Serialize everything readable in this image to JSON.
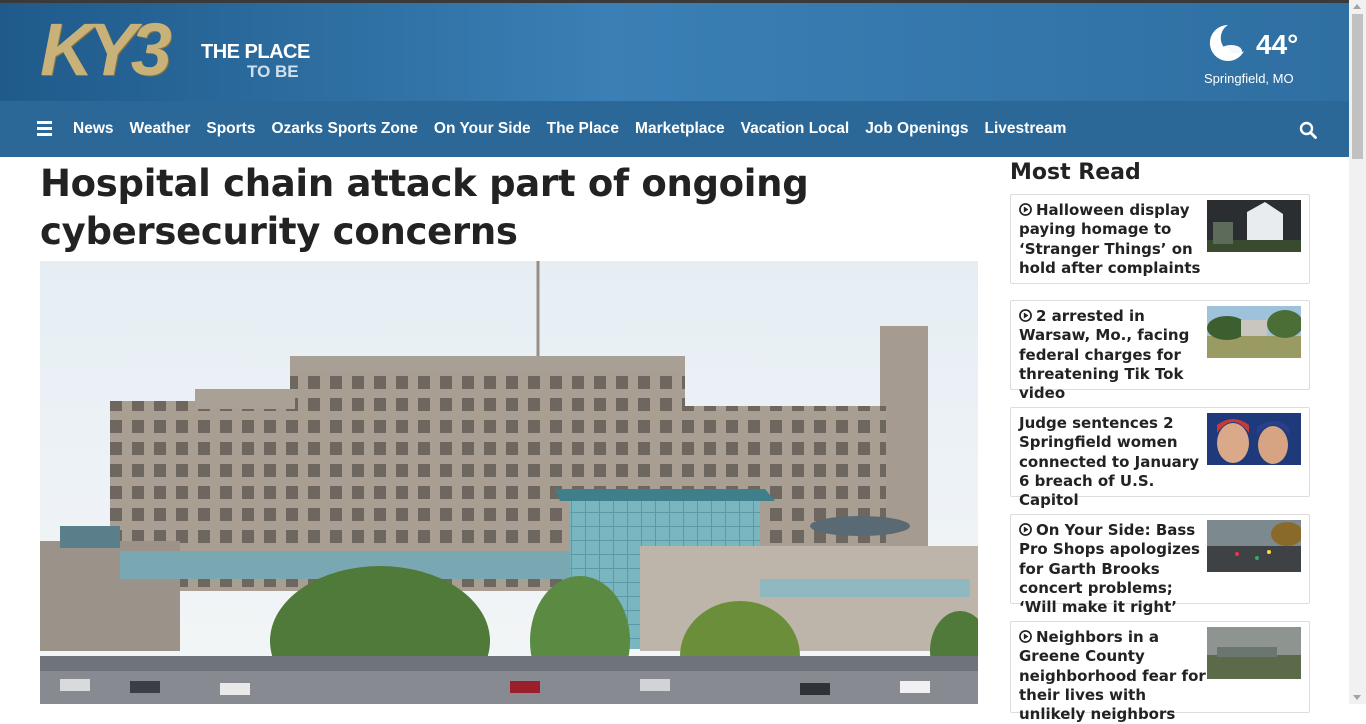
{
  "brand": {
    "logo_mark": "KY3",
    "tagline_1": "THE PLACE",
    "tagline_2": "TO BE"
  },
  "weather": {
    "temp": "44°",
    "city": "Springfield, MO",
    "icon": "moon-cloud-icon"
  },
  "nav": {
    "items": [
      "News",
      "Weather",
      "Sports",
      "Ozarks Sports Zone",
      "On Your Side",
      "The Place",
      "Marketplace",
      "Vacation Local",
      "Job Openings",
      "Livestream"
    ],
    "menu_icon": "hamburger-icon",
    "search_icon": "search-icon"
  },
  "article": {
    "headline": "Hospital chain attack part of ongoing cybersecurity concerns"
  },
  "sidebar": {
    "heading": "Most Read",
    "items": [
      {
        "title": "Halloween display paying homage to ‘Stranger Things’ on hold after complaints",
        "video": true
      },
      {
        "title": "2 arrested in Warsaw, Mo., facing federal charges for threatening Tik Tok video",
        "video": true
      },
      {
        "title": "Judge sentences 2 Springfield women connected to January 6 breach of U.S. Capitol",
        "video": false
      },
      {
        "title": "On Your Side: Bass Pro Shops apologizes for Garth Brooks concert problems; ‘Will make it right’",
        "video": true
      },
      {
        "title": "Neighbors in a Greene County neighborhood fear for their lives with unlikely neighbors",
        "video": true
      }
    ]
  },
  "colors": {
    "header": "#2f6fa2",
    "nav": "#2b6898",
    "logo_gold": "#c8b27a"
  }
}
